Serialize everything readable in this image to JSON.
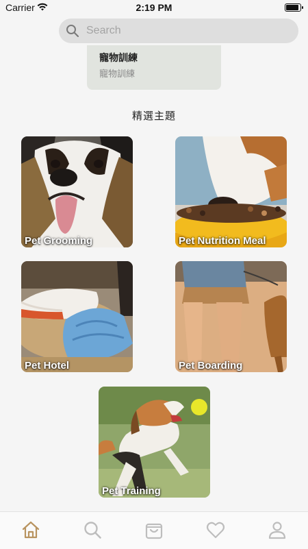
{
  "status_bar": {
    "carrier": "Carrier",
    "time": "2:19 PM"
  },
  "search": {
    "placeholder": "Search"
  },
  "suggestion": {
    "title": "寵物訓練",
    "subtitle": "寵物訓練"
  },
  "section": {
    "title": "精選主題"
  },
  "topics": [
    {
      "label": "Pet Grooming"
    },
    {
      "label": "Pet Nutrition Meal"
    },
    {
      "label": "Pet Hotel"
    },
    {
      "label": "Pet Boarding"
    },
    {
      "label": "Pet Training"
    }
  ],
  "tabbar": {
    "active_color": "#b8935f",
    "inactive_color": "#bdbdbd",
    "items": [
      "home-icon",
      "search-icon",
      "bag-icon",
      "heart-icon",
      "profile-icon"
    ]
  }
}
